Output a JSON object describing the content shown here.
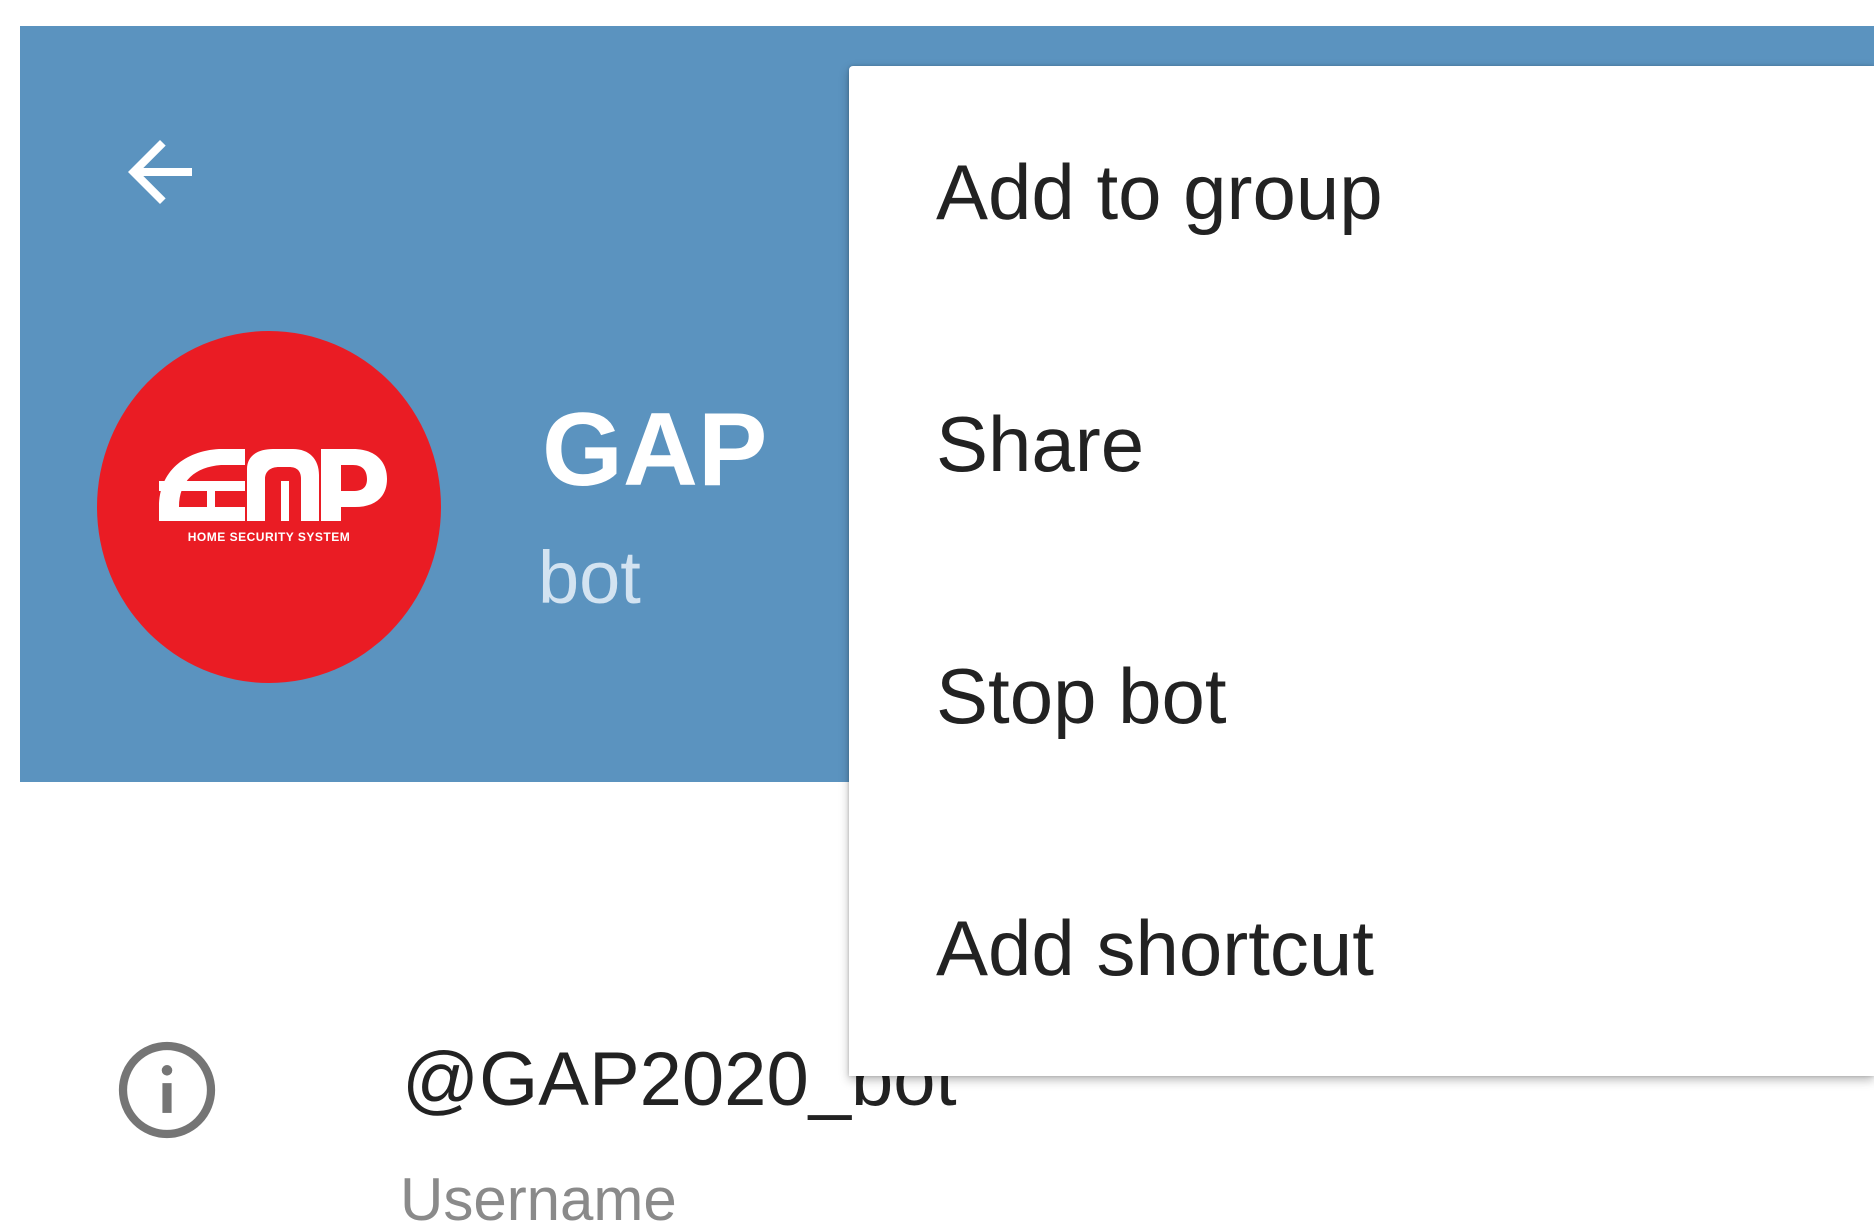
{
  "toolbar": {
    "back_icon": "arrow-left-icon"
  },
  "profile": {
    "name": "GAP",
    "status": "bot",
    "avatar": {
      "logo_text": "GAP",
      "logo_subtext": "HOME SECURITY SYSTEM",
      "background_color": "#ea1c24",
      "logo_color": "#ffffff"
    }
  },
  "info": {
    "icon": "info-icon",
    "username": "@GAP2020_bot",
    "username_label": "Username"
  },
  "menu": {
    "items": [
      {
        "label": "Add to group"
      },
      {
        "label": "Share"
      },
      {
        "label": "Stop bot"
      },
      {
        "label": "Add shortcut"
      }
    ]
  },
  "colors": {
    "header_background": "#5b93bf",
    "status_text": "#d3e3f1",
    "primary_text": "#222222",
    "secondary_text": "#8a8a8a"
  }
}
